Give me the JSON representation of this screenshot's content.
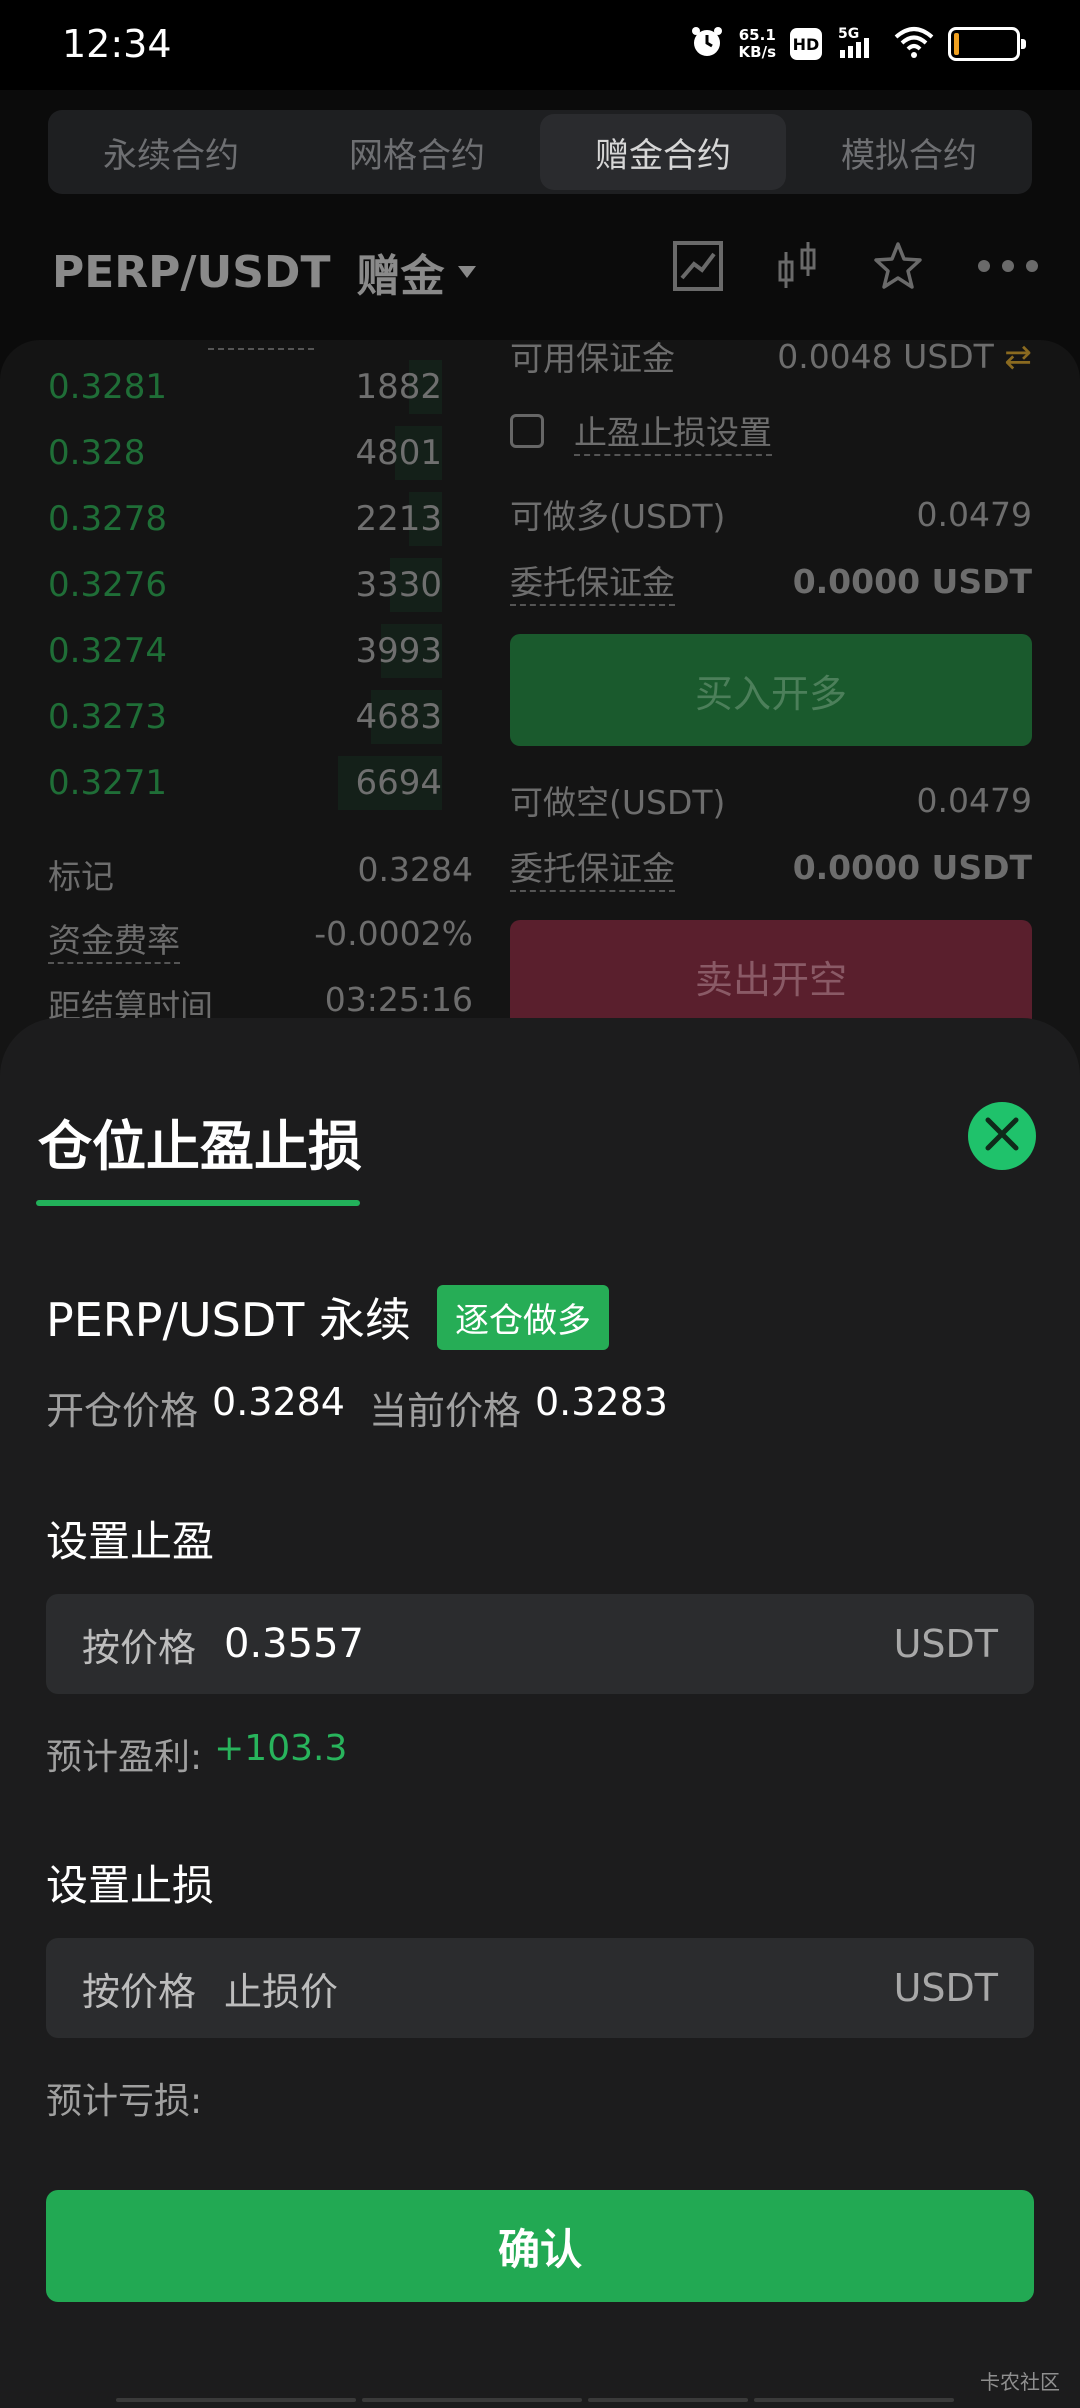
{
  "status_bar": {
    "time": "12:34",
    "net_speed_value": "65.1",
    "net_speed_unit": "KB/s",
    "hd_label": "HD",
    "network_label": "5G",
    "battery_level": 0.08
  },
  "tabs": [
    {
      "label": "永续合约",
      "active": false
    },
    {
      "label": "网格合约",
      "active": false
    },
    {
      "label": "赠金合约",
      "active": true
    },
    {
      "label": "模拟合约",
      "active": false
    }
  ],
  "pair": {
    "name": "PERP/USDT",
    "tag": "赠金"
  },
  "order_book": [
    {
      "price": "0.3281",
      "qty": "1882",
      "depth": 0.07
    },
    {
      "price": "0.328",
      "qty": "4801",
      "depth": 0.1
    },
    {
      "price": "0.3278",
      "qty": "2213",
      "depth": 0.07
    },
    {
      "price": "0.3276",
      "qty": "3330",
      "depth": 0.11
    },
    {
      "price": "0.3274",
      "qty": "3993",
      "depth": 0.13
    },
    {
      "price": "0.3273",
      "qty": "4683",
      "depth": 0.15
    },
    {
      "price": "0.3271",
      "qty": "6694",
      "depth": 0.22
    }
  ],
  "market_info": {
    "mark_label": "标记",
    "mark_value": "0.3284",
    "funding_label": "资金费率",
    "funding_value": "-0.0002%",
    "settle_label": "距结算时间",
    "settle_value": "03:25:16"
  },
  "trade_panel": {
    "available_label": "可用保证金",
    "available_value": "0.0048 USDT",
    "tpsl_setting_label": "止盈止损设置",
    "long_label": "可做多(USDT)",
    "long_value": "0.0479",
    "margin_label_1": "委托保证金",
    "margin_value_1": "0.0000 USDT",
    "buy_label": "买入开多",
    "short_label": "可做空(USDT)",
    "short_value": "0.0479",
    "margin_label_2": "委托保证金",
    "margin_value_2": "0.0000 USDT",
    "sell_label": "卖出开空"
  },
  "sheet": {
    "title": "仓位止盈止损",
    "position_pair": "PERP/USDT 永续",
    "position_badge": "逐仓做多",
    "open_price_label": "开仓价格",
    "open_price_value": "0.3284",
    "current_price_label": "当前价格",
    "current_price_value": "0.3283",
    "tp_title": "设置止盈",
    "tp_prefix": "按价格",
    "tp_value": "0.3557",
    "tp_unit": "USDT",
    "tp_est_label": "预计盈利:",
    "tp_est_value": "+103.3",
    "sl_title": "设置止损",
    "sl_prefix": "按价格",
    "sl_placeholder": "止损价",
    "sl_unit": "USDT",
    "sl_est_label": "预计亏损:",
    "confirm_label": "确认",
    "watermark": "卡农社区"
  },
  "colors": {
    "accent_green": "#22a953",
    "profit_green": "#28b45c",
    "sell_red": "#5a1f2d"
  }
}
